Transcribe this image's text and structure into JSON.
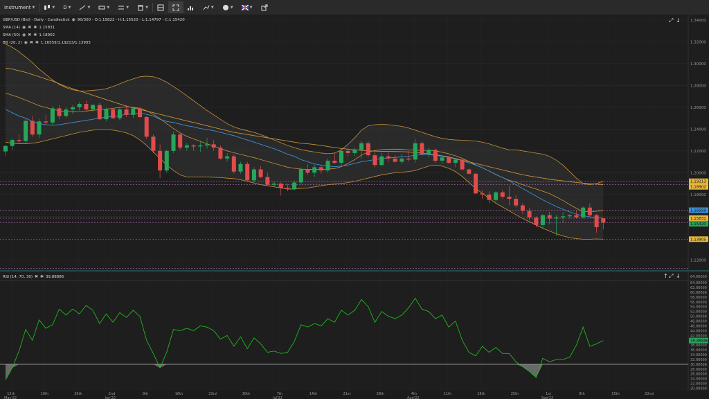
{
  "toolbar": {
    "instrument_label": "Instrument",
    "timeframe_label": "D",
    "items": [
      "candles-icon",
      "trendline-icon",
      "ruler-icon",
      "compare-icon",
      "trash-icon",
      "layout-icon",
      "fullscreen-icon",
      "chart-type-icon",
      "draw-icon",
      "color-icon",
      "flag-icon",
      "share-icon"
    ]
  },
  "legend": {
    "main": "GBP/USD (Bid) - Daily - Candlestick",
    "main_stats": "90/300 - O:1.15822 - H:1.15520 - L:1.14797 - C:1.15420",
    "sma14_label": "SMA (14)",
    "sma14_value": "1.15831",
    "sma50_label": "SMA (50)",
    "sma50_value": "1.18902",
    "bb_label": "BB (20, 2)",
    "bb_value": "1.16559/1.19213/1.13905",
    "rsi_label": "RSI (14, 70, 30)",
    "rsi_value": "39.88886"
  },
  "colors": {
    "bull": "#26a65b",
    "bear": "#e04c4c",
    "sma14": "#3d8fd6",
    "sma50": "#c8923a",
    "bb": "#c8923a",
    "rsi": "#1fb81f",
    "dotted": "#b06fb0"
  },
  "price_labels": [
    {
      "text": "1.19213",
      "value": 1.19213,
      "bg": "#e5b83d"
    },
    {
      "text": "1.18902",
      "value": 1.18902,
      "bg": "#e5b83d"
    },
    {
      "text": "1.16559",
      "value": 1.16559,
      "bg": "#3d8fd6"
    },
    {
      "text": "1.15831",
      "value": 1.15831,
      "bg": "#e5b83d"
    },
    {
      "text": "1.15420",
      "value": 1.1542,
      "bg": "#26a65b"
    },
    {
      "text": "1.13905",
      "value": 1.13905,
      "bg": "#e5b83d"
    }
  ],
  "rsi_current_label": "39.88886",
  "chart_data": {
    "type": "candlestick",
    "price_axis": [
      "1.34000",
      "1.32000",
      "1.30000",
      "1.28000",
      "1.26000",
      "1.24000",
      "1.22000",
      "1.20000",
      "1.18000",
      "1.16000",
      "1.14000",
      "1.12000"
    ],
    "ylim": [
      1.11,
      1.345
    ],
    "rsi_axis": [
      "64.00000",
      "62.00000",
      "60.00000",
      "58.00000",
      "56.00000",
      "54.00000",
      "52.00000",
      "50.00000",
      "48.00000",
      "46.00000",
      "44.00000",
      "42.00000",
      "40.00000",
      "38.00000",
      "36.00000",
      "34.00000",
      "32.00000",
      "30.00000",
      "28.00000",
      "26.00000",
      "24.00000",
      "22.00000",
      "20.00000"
    ],
    "rsi_ylim": [
      19,
      64.6
    ],
    "rsi_header_value": "64.00000",
    "x_ticks": [
      "12th",
      "19th",
      "26th",
      "2nd",
      "9th",
      "16th",
      "23rd",
      "30th",
      "7th",
      "14th",
      "21st",
      "28th",
      "4th",
      "11th",
      "18th",
      "25th",
      "1st",
      "8th",
      "15th",
      "22nd"
    ],
    "month_labels": [
      {
        "text": "May'22",
        "tick": 0
      },
      {
        "text": "Jun'22",
        "tick": 3
      },
      {
        "text": "Jul'22",
        "tick": 8
      },
      {
        "text": "Aug'22",
        "tick": 12
      },
      {
        "text": "Sep'22",
        "tick": 16
      }
    ],
    "candles": [
      [
        1.2195,
        1.2255,
        1.2158,
        1.2245
      ],
      [
        1.2245,
        1.2315,
        1.221,
        1.23
      ],
      [
        1.23,
        1.2355,
        1.2275,
        1.229
      ],
      [
        1.229,
        1.2495,
        1.227,
        1.2475
      ],
      [
        1.2475,
        1.252,
        1.233,
        1.235
      ],
      [
        1.235,
        1.249,
        1.232,
        1.247
      ],
      [
        1.247,
        1.253,
        1.244,
        1.246
      ],
      [
        1.246,
        1.261,
        1.244,
        1.259
      ],
      [
        1.259,
        1.262,
        1.249,
        1.252
      ],
      [
        1.252,
        1.26,
        1.25,
        1.258
      ],
      [
        1.258,
        1.262,
        1.254,
        1.26
      ],
      [
        1.26,
        1.265,
        1.257,
        1.263
      ],
      [
        1.263,
        1.266,
        1.256,
        1.258
      ],
      [
        1.258,
        1.263,
        1.256,
        1.262
      ],
      [
        1.262,
        1.264,
        1.248,
        1.249
      ],
      [
        1.249,
        1.26,
        1.247,
        1.258
      ],
      [
        1.258,
        1.259,
        1.249,
        1.25
      ],
      [
        1.25,
        1.26,
        1.248,
        1.258
      ],
      [
        1.258,
        1.262,
        1.251,
        1.253
      ],
      [
        1.253,
        1.26,
        1.25,
        1.259
      ],
      [
        1.259,
        1.26,
        1.25,
        1.251
      ],
      [
        1.251,
        1.252,
        1.231,
        1.233
      ],
      [
        1.233,
        1.235,
        1.218,
        1.22
      ],
      [
        1.22,
        1.226,
        1.195,
        1.202
      ],
      [
        1.202,
        1.221,
        1.2,
        1.22
      ],
      [
        1.22,
        1.238,
        1.218,
        1.235
      ],
      [
        1.235,
        1.236,
        1.221,
        1.223
      ],
      [
        1.223,
        1.227,
        1.22,
        1.225
      ],
      [
        1.225,
        1.226,
        1.22,
        1.224
      ],
      [
        1.224,
        1.229,
        1.219,
        1.225
      ],
      [
        1.225,
        1.232,
        1.222,
        1.226
      ],
      [
        1.226,
        1.23,
        1.22,
        1.223
      ],
      [
        1.223,
        1.225,
        1.212,
        1.213
      ],
      [
        1.213,
        1.218,
        1.21,
        1.215
      ],
      [
        1.215,
        1.217,
        1.199,
        1.201
      ],
      [
        1.201,
        1.21,
        1.199,
        1.208
      ],
      [
        1.208,
        1.21,
        1.192,
        1.193
      ],
      [
        1.193,
        1.205,
        1.19,
        1.203
      ],
      [
        1.203,
        1.206,
        1.195,
        1.196
      ],
      [
        1.196,
        1.2,
        1.188,
        1.189
      ],
      [
        1.189,
        1.192,
        1.187,
        1.19
      ],
      [
        1.19,
        1.191,
        1.179,
        1.186
      ],
      [
        1.186,
        1.19,
        1.183,
        1.185
      ],
      [
        1.185,
        1.193,
        1.184,
        1.191
      ],
      [
        1.191,
        1.205,
        1.189,
        1.203
      ],
      [
        1.203,
        1.208,
        1.198,
        1.2
      ],
      [
        1.2,
        1.207,
        1.196,
        1.205
      ],
      [
        1.205,
        1.207,
        1.199,
        1.202
      ],
      [
        1.202,
        1.213,
        1.2,
        1.211
      ],
      [
        1.211,
        1.218,
        1.208,
        1.209
      ],
      [
        1.209,
        1.222,
        1.207,
        1.22
      ],
      [
        1.22,
        1.223,
        1.215,
        1.218
      ],
      [
        1.218,
        1.223,
        1.215,
        1.221
      ],
      [
        1.221,
        1.229,
        1.213,
        1.227
      ],
      [
        1.227,
        1.229,
        1.214,
        1.216
      ],
      [
        1.216,
        1.219,
        1.205,
        1.207
      ],
      [
        1.207,
        1.218,
        1.206,
        1.215
      ],
      [
        1.215,
        1.22,
        1.21,
        1.213
      ],
      [
        1.213,
        1.216,
        1.209,
        1.21
      ],
      [
        1.21,
        1.217,
        1.208,
        1.213
      ],
      [
        1.213,
        1.22,
        1.21,
        1.212
      ],
      [
        1.212,
        1.231,
        1.209,
        1.227
      ],
      [
        1.227,
        1.229,
        1.216,
        1.217
      ],
      [
        1.217,
        1.223,
        1.214,
        1.221
      ],
      [
        1.221,
        1.222,
        1.209,
        1.211
      ],
      [
        1.211,
        1.216,
        1.208,
        1.214
      ],
      [
        1.214,
        1.215,
        1.208,
        1.209
      ],
      [
        1.209,
        1.213,
        1.205,
        1.212
      ],
      [
        1.212,
        1.213,
        1.202,
        1.203
      ],
      [
        1.203,
        1.204,
        1.198,
        1.199
      ],
      [
        1.199,
        1.2,
        1.18,
        1.181
      ],
      [
        1.181,
        1.184,
        1.176,
        1.18
      ],
      [
        1.18,
        1.183,
        1.172,
        1.175
      ],
      [
        1.175,
        1.183,
        1.173,
        1.182
      ],
      [
        1.182,
        1.184,
        1.176,
        1.178
      ],
      [
        1.178,
        1.188,
        1.17,
        1.176
      ],
      [
        1.176,
        1.179,
        1.168,
        1.17
      ],
      [
        1.17,
        1.172,
        1.162,
        1.165
      ],
      [
        1.165,
        1.168,
        1.157,
        1.159
      ],
      [
        1.159,
        1.16,
        1.15,
        1.152
      ],
      [
        1.152,
        1.162,
        1.149,
        1.161
      ],
      [
        1.161,
        1.164,
        1.153,
        1.158
      ],
      [
        1.158,
        1.161,
        1.142,
        1.159
      ],
      [
        1.159,
        1.164,
        1.154,
        1.16
      ],
      [
        1.16,
        1.162,
        1.158,
        1.161
      ],
      [
        1.161,
        1.165,
        1.158,
        1.159
      ],
      [
        1.159,
        1.169,
        1.158,
        1.168
      ],
      [
        1.168,
        1.172,
        1.159,
        1.161
      ],
      [
        1.161,
        1.162,
        1.145,
        1.15
      ],
      [
        1.1582,
        1.1552,
        1.148,
        1.1542
      ]
    ],
    "series": [
      {
        "name": "SMA (14)",
        "values": [
          1.258,
          1.255,
          1.252,
          1.25,
          1.247,
          1.245,
          1.244,
          1.2435,
          1.244,
          1.245,
          1.246,
          1.247,
          1.248,
          1.249,
          1.25,
          1.251,
          1.2515,
          1.2525,
          1.2535,
          1.254,
          1.2545,
          1.2535,
          1.252,
          1.249,
          1.247,
          1.246,
          1.2445,
          1.243,
          1.242,
          1.2405,
          1.2395,
          1.2385,
          1.237,
          1.2355,
          1.234,
          1.232,
          1.23,
          1.228,
          1.226,
          1.224,
          1.222,
          1.2195,
          1.217,
          1.215,
          1.212,
          1.21,
          1.208,
          1.207,
          1.206,
          1.2055,
          1.206,
          1.207,
          1.2085,
          1.21,
          1.211,
          1.212,
          1.213,
          1.2135,
          1.214,
          1.2145,
          1.215,
          1.216,
          1.2165,
          1.2165,
          1.216,
          1.215,
          1.214,
          1.2125,
          1.211,
          1.209,
          1.207,
          1.2045,
          1.2015,
          1.1985,
          1.1955,
          1.1925,
          1.189,
          1.1855,
          1.182,
          1.1785,
          1.175,
          1.172,
          1.169,
          1.1665,
          1.164,
          1.162,
          1.1605,
          1.1595,
          1.1586,
          1.1583
        ]
      },
      {
        "name": "SMA (50)",
        "values": [
          1.296,
          1.295,
          1.2935,
          1.292,
          1.29,
          1.288,
          1.286,
          1.284,
          1.2815,
          1.279,
          1.277,
          1.275,
          1.273,
          1.271,
          1.269,
          1.267,
          1.265,
          1.263,
          1.261,
          1.2595,
          1.258,
          1.2565,
          1.255,
          1.2535,
          1.252,
          1.2505,
          1.249,
          1.2475,
          1.246,
          1.2445,
          1.243,
          1.2415,
          1.24,
          1.2385,
          1.237,
          1.236,
          1.235,
          1.234,
          1.233,
          1.232,
          1.231,
          1.23,
          1.229,
          1.228,
          1.227,
          1.2265,
          1.2258,
          1.225,
          1.224,
          1.223,
          1.2222,
          1.2215,
          1.221,
          1.2205,
          1.22,
          1.2198,
          1.2196,
          1.2195,
          1.2194,
          1.2193,
          1.219,
          1.2185,
          1.218,
          1.2172,
          1.2165,
          1.2155,
          1.2145,
          1.213,
          1.2115,
          1.21,
          1.2085,
          1.207,
          1.2055,
          1.204,
          1.2025,
          1.201,
          1.1995,
          1.1982,
          1.197,
          1.196,
          1.195,
          1.194,
          1.1932,
          1.1925,
          1.1918,
          1.191,
          1.1904,
          1.19,
          1.1895,
          1.189
        ]
      },
      {
        "name": "BB (20, 2) upper",
        "values": [
          1.318,
          1.315,
          1.311,
          1.306,
          1.301,
          1.295,
          1.29,
          1.285,
          1.281,
          1.278,
          1.276,
          1.275,
          1.275,
          1.2755,
          1.276,
          1.277,
          1.279,
          1.2815,
          1.284,
          1.286,
          1.288,
          1.2885,
          1.288,
          1.286,
          1.283,
          1.279,
          1.275,
          1.2705,
          1.266,
          1.2615,
          1.257,
          1.253,
          1.249,
          1.245,
          1.242,
          1.24,
          1.2385,
          1.237,
          1.235,
          1.2325,
          1.23,
          1.2275,
          1.225,
          1.223,
          1.2212,
          1.22,
          1.219,
          1.218,
          1.2175,
          1.218,
          1.221,
          1.226,
          1.232,
          1.239,
          1.243,
          1.244,
          1.2445,
          1.244,
          1.2432,
          1.2425,
          1.241,
          1.239,
          1.237,
          1.235,
          1.233,
          1.2315,
          1.2305,
          1.23,
          1.2298,
          1.2295,
          1.229,
          1.228,
          1.2265,
          1.2245,
          1.2225,
          1.221,
          1.221,
          1.22,
          1.219,
          1.218,
          1.217,
          1.215,
          1.2115,
          1.207,
          1.201,
          1.195,
          1.19,
          1.189,
          1.19,
          1.1921
        ]
      },
      {
        "name": "BB (20, 2) lower",
        "values": [
          1.228,
          1.227,
          1.2265,
          1.2265,
          1.227,
          1.228,
          1.2295,
          1.231,
          1.2325,
          1.234,
          1.2355,
          1.237,
          1.238,
          1.239,
          1.2395,
          1.2395,
          1.239,
          1.238,
          1.2365,
          1.234,
          1.23,
          1.225,
          1.219,
          1.213,
          1.207,
          1.202,
          1.198,
          1.196,
          1.196,
          1.196,
          1.196,
          1.1958,
          1.1955,
          1.195,
          1.1945,
          1.1935,
          1.192,
          1.1905,
          1.189,
          1.188,
          1.187,
          1.186,
          1.185,
          1.185,
          1.1855,
          1.186,
          1.187,
          1.188,
          1.189,
          1.1895,
          1.19,
          1.191,
          1.192,
          1.1935,
          1.195,
          1.1965,
          1.198,
          1.199,
          1.2,
          1.2005,
          1.201,
          1.202,
          1.204,
          1.206,
          1.207,
          1.206,
          1.204,
          1.201,
          1.1965,
          1.191,
          1.1855,
          1.181,
          1.1765,
          1.172,
          1.1685,
          1.165,
          1.1615,
          1.158,
          1.155,
          1.152,
          1.149,
          1.1465,
          1.144,
          1.142,
          1.1405,
          1.1395,
          1.139,
          1.139,
          1.1392,
          1.139
        ]
      },
      {
        "name": "BB (20, 2) middle",
        "values": [
          1.273,
          1.271,
          1.269,
          1.2665,
          1.264,
          1.2615,
          1.2598,
          1.258,
          1.2568,
          1.256,
          1.2558,
          1.256,
          1.2565,
          1.2572,
          1.2578,
          1.2583,
          1.259,
          1.2598,
          1.2603,
          1.26,
          1.259,
          1.2568,
          1.2535,
          1.2495,
          1.245,
          1.2405,
          1.2365,
          1.2333,
          1.231,
          1.2288,
          1.2265,
          1.2244,
          1.2222,
          1.22,
          1.2183,
          1.2168,
          1.2153,
          1.2138,
          1.212,
          1.2103,
          1.2085,
          1.2068,
          1.205,
          1.204,
          1.2033,
          1.203,
          1.203,
          1.203,
          1.2033,
          1.2038,
          1.2055,
          1.2085,
          1.212,
          1.2162,
          1.219,
          1.2203,
          1.2213,
          1.2215,
          1.2216,
          1.2215,
          1.221,
          1.2205,
          1.2205,
          1.2205,
          1.22,
          1.2188,
          1.2173,
          1.2155,
          1.2132,
          1.2103,
          1.2073,
          1.2045,
          1.2015,
          1.1983,
          1.1955,
          1.193,
          1.1913,
          1.189,
          1.187,
          1.185,
          1.183,
          1.1808,
          1.1778,
          1.1745,
          1.1708,
          1.1673,
          1.1645,
          1.164,
          1.1646,
          1.1656
        ]
      },
      {
        "name": "RSI (14, 70, 30)",
        "values": [
          23.5,
          28.5,
          35.5,
          44.5,
          40.0,
          48.5,
          45.0,
          46.5,
          53.0,
          50.5,
          53.0,
          51.0,
          54.5,
          52.5,
          47.0,
          51.0,
          47.5,
          51.5,
          49.5,
          52.5,
          50.0,
          40.0,
          34.5,
          28.5,
          35.0,
          44.5,
          44.0,
          45.0,
          44.0,
          46.0,
          45.5,
          44.0,
          40.5,
          42.0,
          37.5,
          41.5,
          36.5,
          41.0,
          38.5,
          35.0,
          35.5,
          34.5,
          35.0,
          39.5,
          46.5,
          45.5,
          47.0,
          46.0,
          49.0,
          47.5,
          52.5,
          50.5,
          52.5,
          57.0,
          54.0,
          47.5,
          52.0,
          50.0,
          49.0,
          50.5,
          53.5,
          57.5,
          53.0,
          52.0,
          49.0,
          50.5,
          45.5,
          48.0,
          40.0,
          35.0,
          33.5,
          37.5,
          35.0,
          37.0,
          34.5,
          34.5,
          31.0,
          29.0,
          27.0,
          24.5,
          32.5,
          31.0,
          32.0,
          32.0,
          33.0,
          38.0,
          45.5,
          37.5,
          38.5,
          39.88886
        ]
      }
    ],
    "rsi_levels": [
      70,
      30
    ],
    "horizontal_markers": [
      1.19213,
      1.18902,
      1.16559,
      1.15831,
      1.1542,
      1.13905
    ]
  }
}
